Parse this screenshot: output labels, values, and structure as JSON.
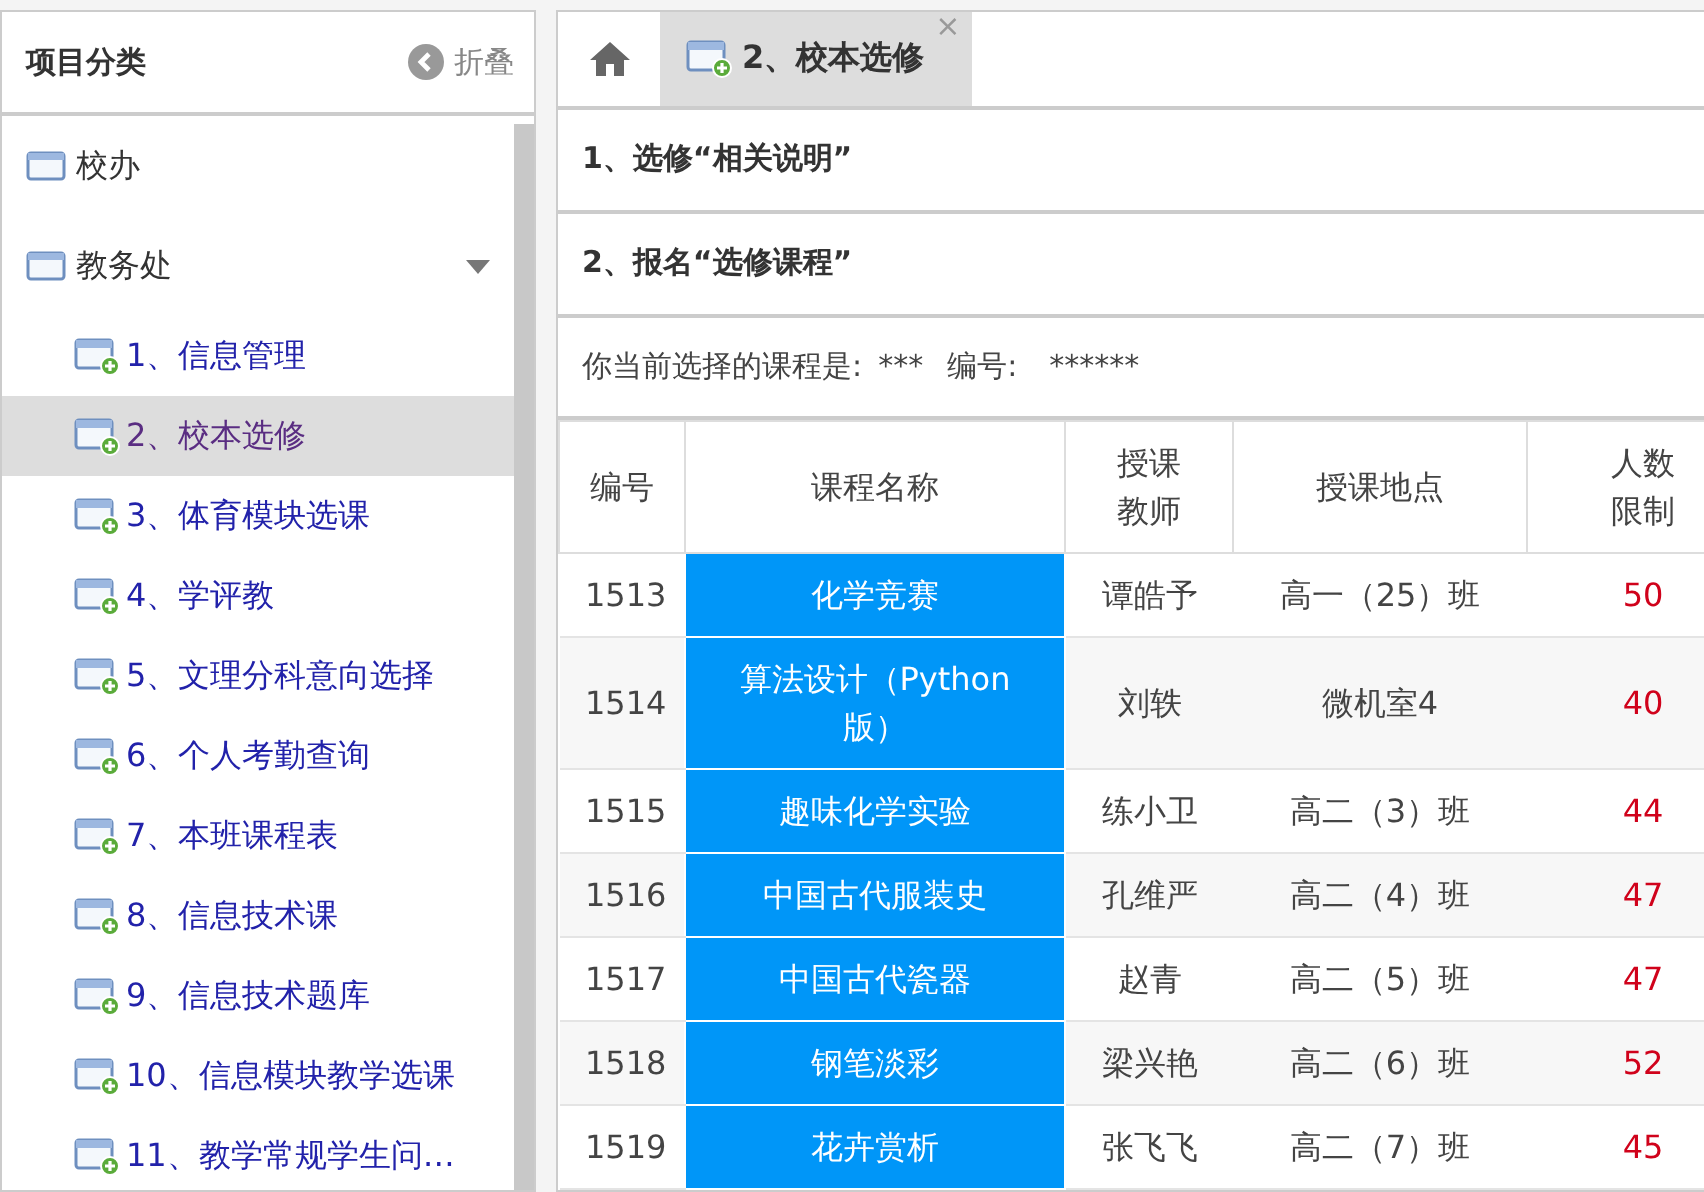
{
  "sidebar": {
    "title": "项目分类",
    "collapse_label": "折叠",
    "groups": [
      {
        "label": "校办",
        "expanded": false
      },
      {
        "label": "教务处",
        "expanded": true,
        "children": [
          {
            "label": "1、信息管理",
            "selected": false
          },
          {
            "label": "2、校本选修",
            "selected": true
          },
          {
            "label": "3、体育模块选课",
            "selected": false
          },
          {
            "label": "4、学评教",
            "selected": false
          },
          {
            "label": "5、文理分科意向选择",
            "selected": false
          },
          {
            "label": "6、个人考勤查询",
            "selected": false
          },
          {
            "label": "7、本班课程表",
            "selected": false
          },
          {
            "label": "8、信息技术课",
            "selected": false
          },
          {
            "label": "9、信息技术题库",
            "selected": false
          },
          {
            "label": "10、信息模块教学选课",
            "selected": false
          },
          {
            "label": "11、教学常规学生问…",
            "selected": false
          }
        ]
      }
    ]
  },
  "tabs": [
    {
      "label": "2、校本选修",
      "selected": true,
      "close": "×"
    }
  ],
  "sections": [
    "1、选修“相关说明”",
    "2、报名“选修课程”"
  ],
  "selection_info": {
    "label": "你当前选择的课程是:",
    "course": "***",
    "number_label": "编号:",
    "number": "******"
  },
  "table": {
    "columns": [
      "编号",
      "课程名称",
      "授课教师",
      "授课地点",
      "人数限制"
    ],
    "rows": [
      [
        "1513",
        "化学竞赛",
        "谭皓予",
        "高一（25）班",
        "50"
      ],
      [
        "1514",
        "算法设计（Python版）",
        "刘轶",
        "微机室4",
        "40"
      ],
      [
        "1515",
        "趣味化学实验",
        "练小卫",
        "高二（3）班",
        "44"
      ],
      [
        "1516",
        "中国古代服装史",
        "孔维严",
        "高二（4）班",
        "47"
      ],
      [
        "1517",
        "中国古代瓷器",
        "赵青",
        "高二（5）班",
        "47"
      ],
      [
        "1518",
        "钢笔淡彩",
        "梁兴艳",
        "高二（6）班",
        "52"
      ],
      [
        "1519",
        "花卉赏析",
        "张飞飞",
        "高二（7）班",
        "45"
      ]
    ]
  }
}
